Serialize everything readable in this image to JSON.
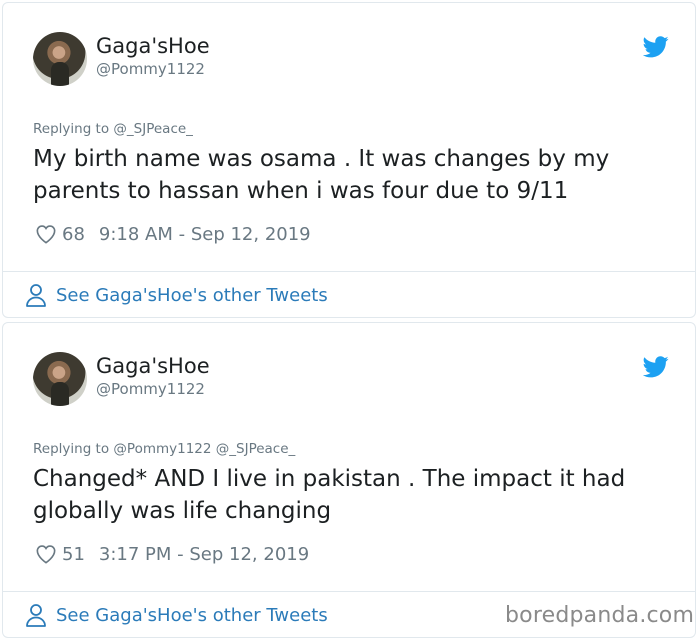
{
  "tweets": [
    {
      "name": "Gaga'sHoe",
      "handle": "@Pommy1122",
      "replying_prefix": "Replying to",
      "replying_to": "@_SJPeace_",
      "text": "My birth name was osama . It was changes by my parents to hassan when i was four due to 9/11",
      "likes": "68",
      "timestamp": "9:18 AM - Sep 12, 2019",
      "see_more": "See Gaga'sHoe's other Tweets"
    },
    {
      "name": "Gaga'sHoe",
      "handle": "@Pommy1122",
      "replying_prefix": "Replying to",
      "replying_to": "@Pommy1122 @_SJPeace_",
      "text": "Changed* AND I live in pakistan . The impact it had globally was life changing",
      "likes": "51",
      "timestamp": "3:17 PM - Sep 12, 2019",
      "see_more": "See Gaga'sHoe's other Tweets"
    }
  ],
  "watermark": "boredpanda.com",
  "colors": {
    "link": "#2b7bb9",
    "muted": "#697882",
    "twitter_blue": "#1da1f2",
    "border": "#e1e8ed"
  },
  "icons": {
    "brand": "twitter-bird-icon",
    "like": "heart-icon",
    "profile": "person-icon"
  }
}
